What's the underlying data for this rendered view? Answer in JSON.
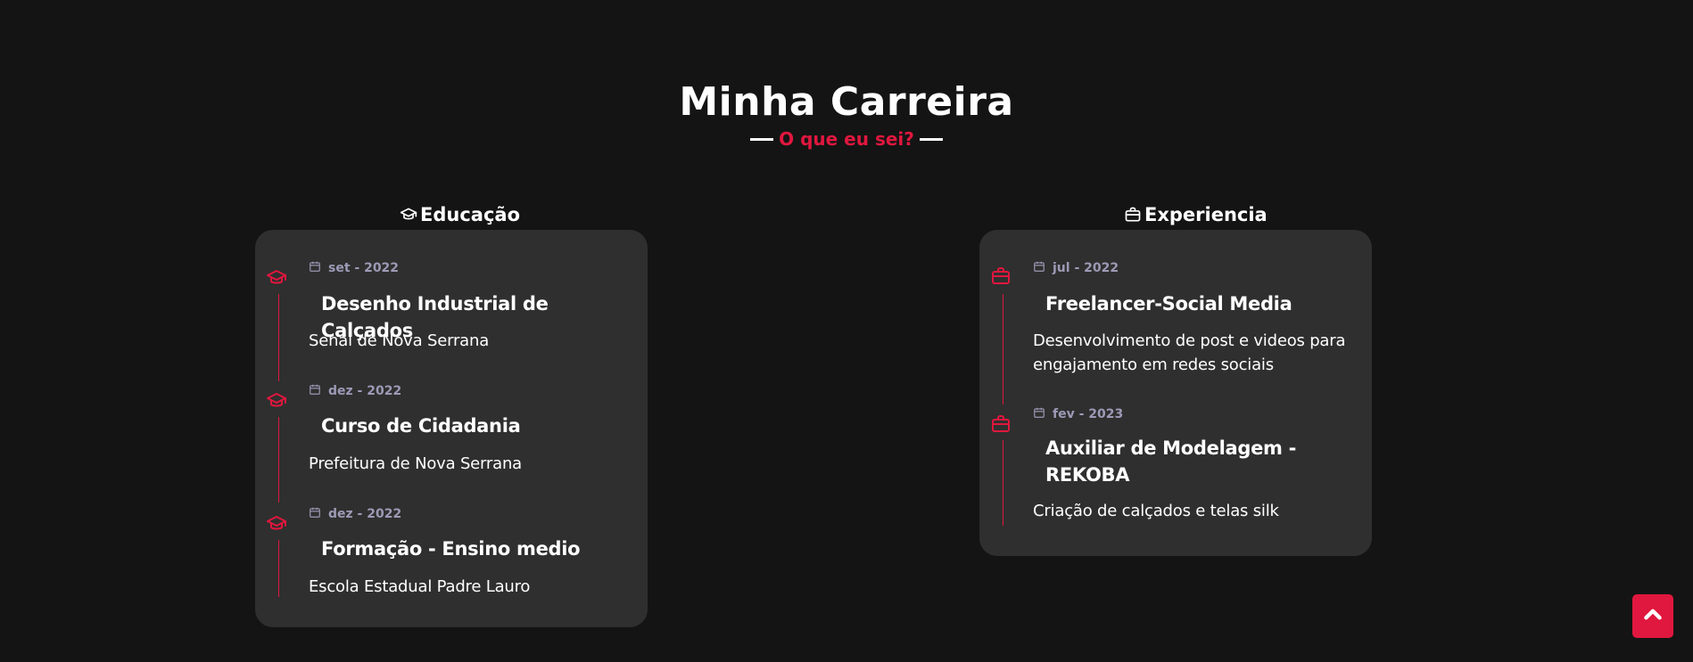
{
  "header": {
    "title": "Minha Carreira",
    "subtitle": "O que eu sei?"
  },
  "education": {
    "heading": "Educação",
    "icon": "graduation-cap-icon",
    "items": [
      {
        "date": "set - 2022",
        "title": "Desenho Industrial de Calçados",
        "desc": "Senai de Nova Serrana"
      },
      {
        "date": "dez - 2022",
        "title": "Curso de Cidadania",
        "desc": "Prefeitura de Nova Serrana"
      },
      {
        "date": "dez - 2022",
        "title": "Formação - Ensino medio",
        "desc": "Escola Estadual Padre Lauro"
      }
    ]
  },
  "experience": {
    "heading": "Experiencia",
    "icon": "briefcase-icon",
    "items": [
      {
        "date": "jul - 2022",
        "title": "Freelancer-Social Media",
        "desc": "Desenvolvimento de post e videos para engajamento em redes sociais"
      },
      {
        "date": "fev - 2023",
        "title": "Auxiliar de Modelagem - REKOBA",
        "desc": "Criação de calçados e telas silk"
      }
    ]
  },
  "scroll_top": {
    "icon": "chevron-up-icon"
  },
  "colors": {
    "background": "#141414",
    "card": "#2f2f2f",
    "accent": "#e0173e",
    "date": "#9d9ab6"
  }
}
